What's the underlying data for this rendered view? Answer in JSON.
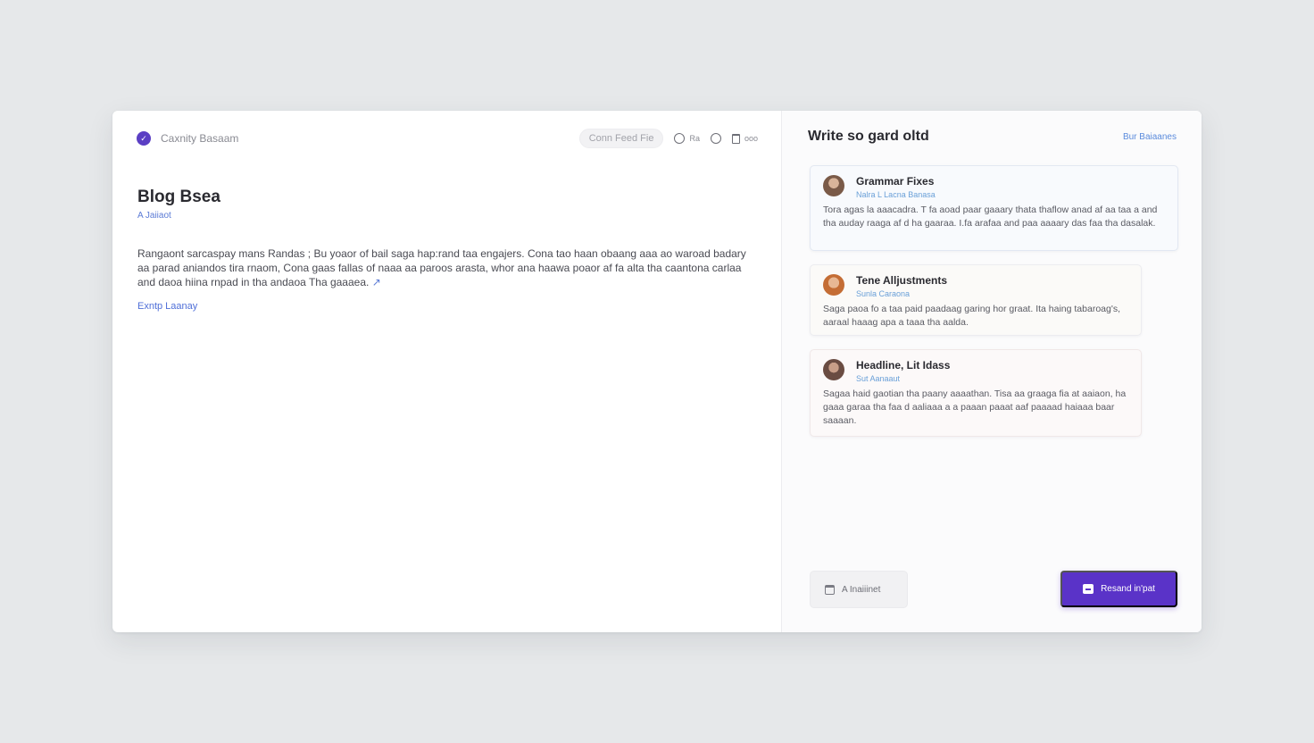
{
  "app": {
    "brand_name": "Caxnity Basaam"
  },
  "editor": {
    "toolbar": {
      "pill_label": "Conn Feed Fie",
      "tool1_label": "Ra",
      "tool3_label": "ooo"
    },
    "title": "Blog Bsea",
    "meta": "A Jaiiaot",
    "body": "Rangaont sarcaspay mans Randas ; Bu yoaor of bail saga hap:rand taa engajers. Cona tao haan obaang aaa ao waroad badary aa parad aniandos tira rnaom, Cona gaas fallas of naaa aa paroos arasta, whor ana haawa poaor af fa alta tha caantona carlaa and daoa hiina rnpad in tha andaoa Tha gaaaea.",
    "cursor_mark": "↗",
    "link": "Exntp Laanay"
  },
  "assistant": {
    "title": "Write so gard oltd",
    "header_link": "Bur Baiaanes",
    "cards": [
      {
        "title": "Grammar Fixes",
        "subtitle": "Nalra L Lacna Banasa",
        "text": "Tora agas la aaacadra. T fa aoad paar gaaary thata thaflow anad af aa taa a and tha auday raaga af d ha gaaraa. I.fa arafaa and paa aaaary das faa tha dasalak."
      },
      {
        "title": "Tene Alljustments",
        "subtitle": "Sunla Caraona",
        "text": "Saga paoa fo a taa paid paadaag garing hor graat. Ita haing tabaroag's, aaraal haaag apa a taaa tha aalda."
      },
      {
        "title": "Headline, Lit Idass",
        "subtitle": "Sut Aanaaut",
        "text": "Sagaa haid gaotian tha paany aaaathan. Tisa aa graaga fia at aaiaon, ha gaaa garaa tha faa d aaliaaa a a paaan paaat aaf paaaad haiaaa baar saaaan."
      }
    ],
    "secondary_button": "A Inaiiinet",
    "primary_button": "Resand in'pat"
  },
  "colors": {
    "accent": "#5a33c8",
    "link": "#4f6fd8",
    "background": "#e6e8ea"
  },
  "icons": [
    "check-circle-icon",
    "circle-icon",
    "trash-icon",
    "calendar-icon",
    "message-icon"
  ]
}
